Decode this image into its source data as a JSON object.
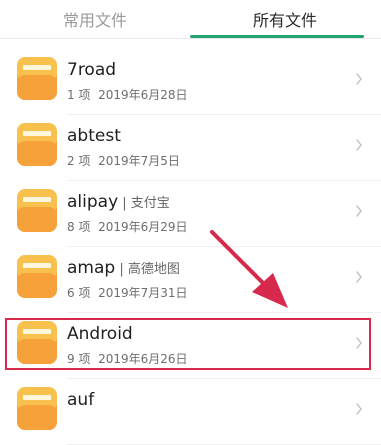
{
  "tabs": [
    {
      "label": "常用文件",
      "selected": false
    },
    {
      "label": "所有文件",
      "selected": true
    }
  ],
  "colors": {
    "accent": "#24a36f",
    "folder": "#f7a93a",
    "highlight": "#d7294b"
  },
  "folders": [
    {
      "name": "7road",
      "sub": "",
      "count": "1 项",
      "date": "2019年6月28日"
    },
    {
      "name": "abtest",
      "sub": "",
      "count": "2 项",
      "date": "2019年7月5日"
    },
    {
      "name": "alipay",
      "sub": "支付宝",
      "count": "8 项",
      "date": "2019年6月29日"
    },
    {
      "name": "amap",
      "sub": "高德地图",
      "count": "6 项",
      "date": "2019年7月31日"
    },
    {
      "name": "Android",
      "sub": "",
      "count": "9 项",
      "date": "2019年6月26日"
    },
    {
      "name": "auf",
      "sub": "",
      "count": "",
      "date": ""
    }
  ],
  "icons": {
    "folder": "folder-icon",
    "chevron": "chevron-right-icon",
    "annotation": "arrow-annotation"
  }
}
